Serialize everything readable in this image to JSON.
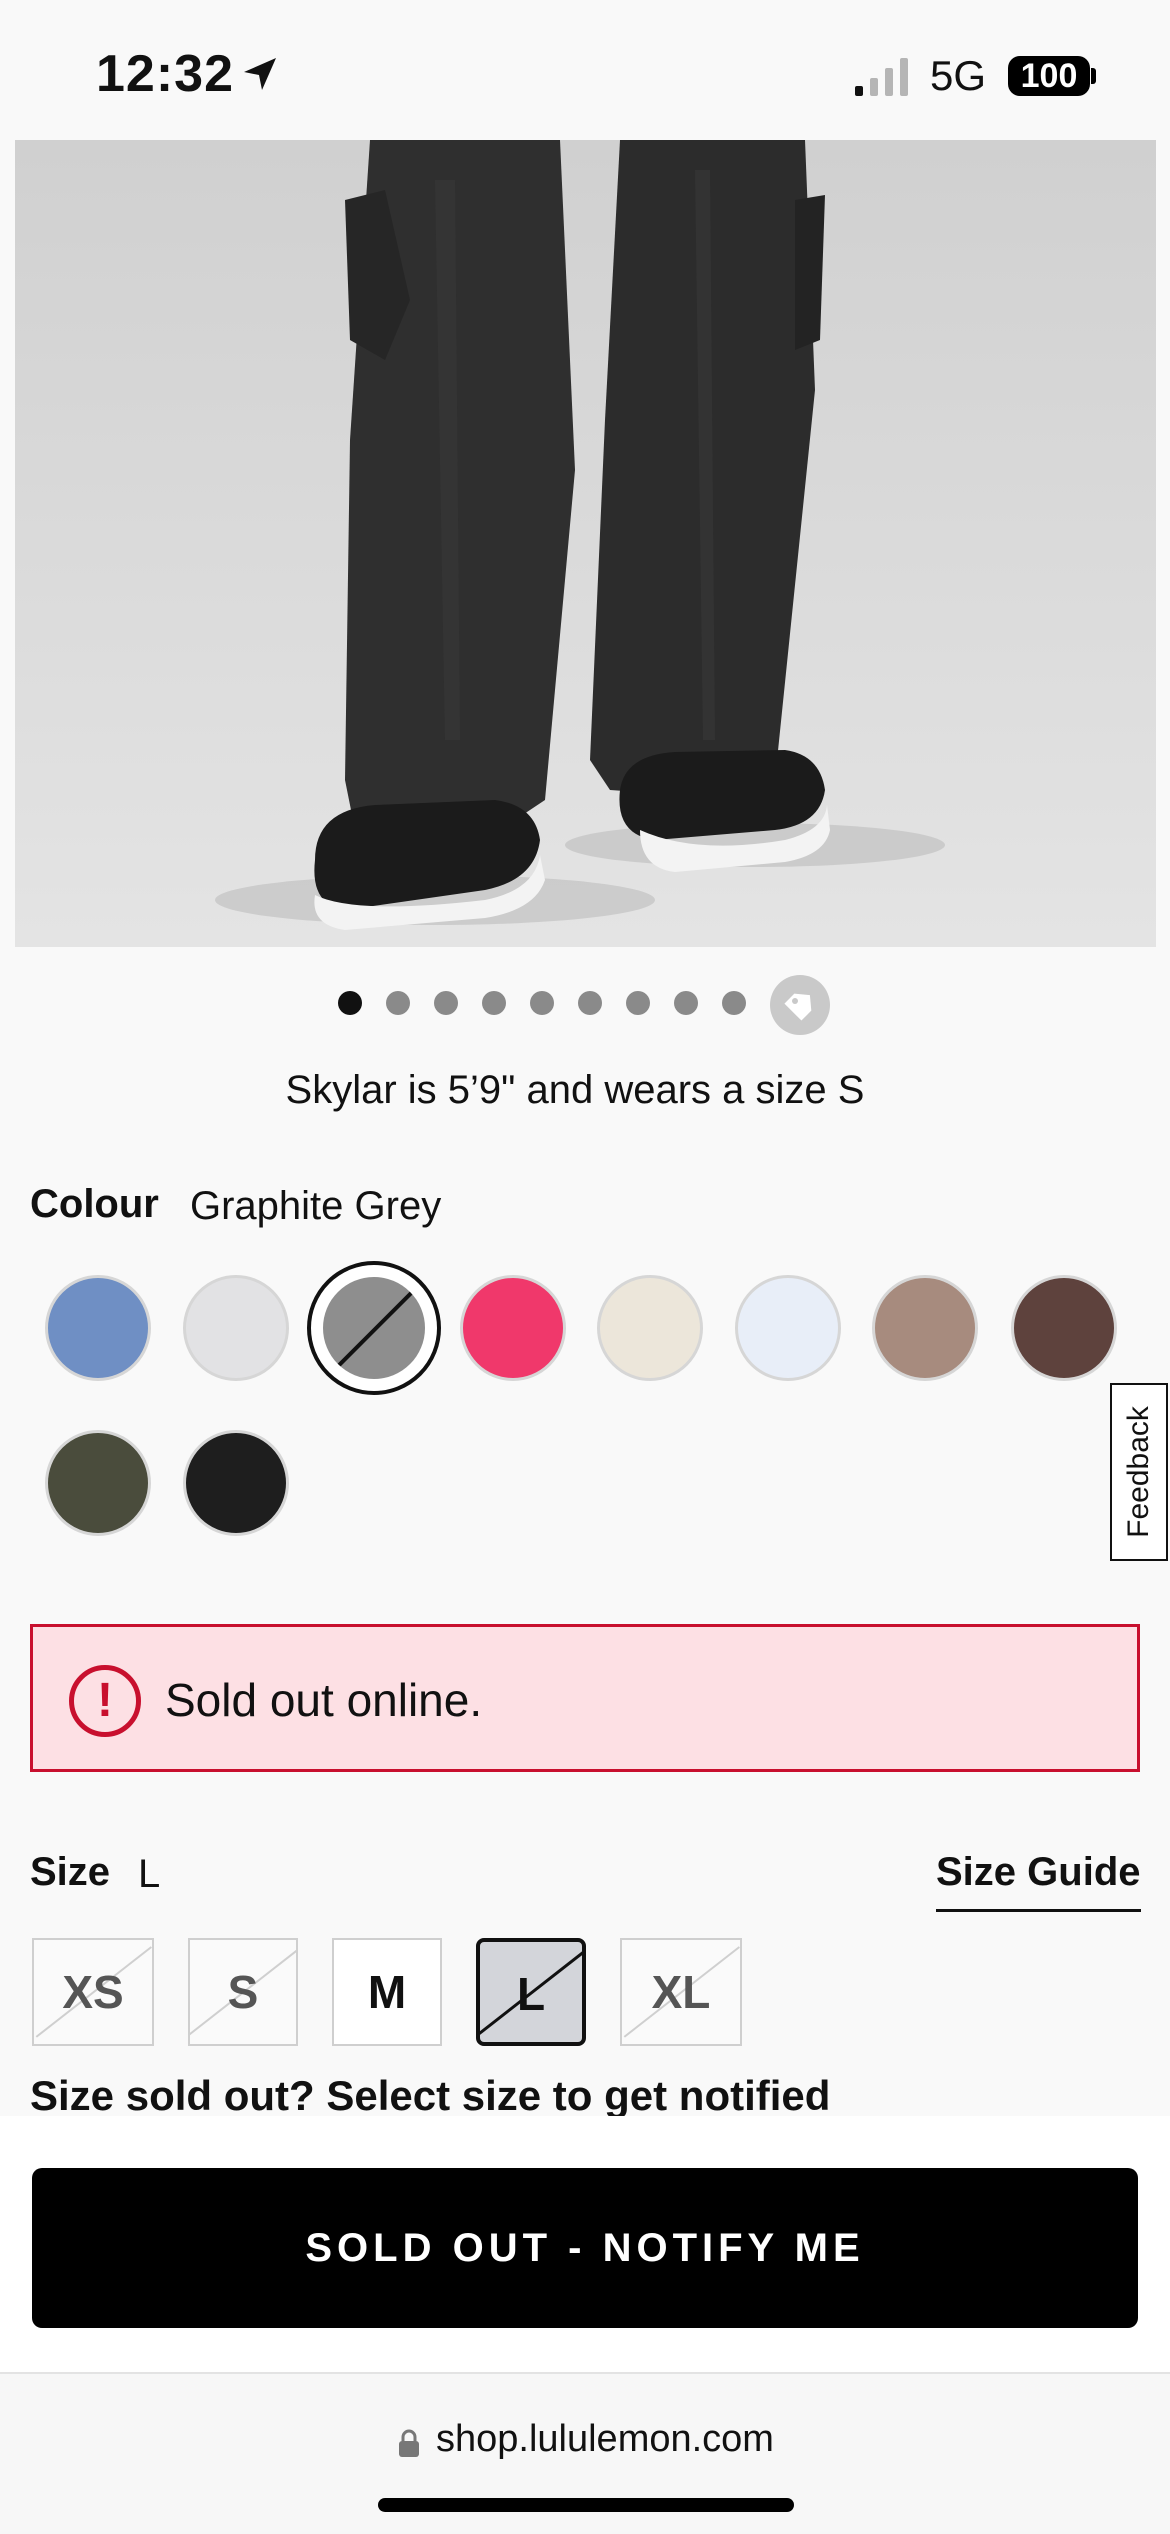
{
  "status_bar": {
    "time": "12:32",
    "network": "5G",
    "battery": "100"
  },
  "gallery": {
    "total_images": 9,
    "active_index": 0
  },
  "model_note": "Skylar is 5’9\" and wears a size S",
  "colour": {
    "label": "Colour",
    "selected_name": "Graphite Grey",
    "swatches": [
      {
        "color": "#6f8fc4"
      },
      {
        "color": "#e2e2e4"
      },
      {
        "color": "#8e8e8e",
        "selected": true,
        "sold_out": true
      },
      {
        "color": "#f0386b"
      },
      {
        "color": "#ece6da"
      },
      {
        "color": "#e8eef8"
      },
      {
        "color": "#a78b7e"
      },
      {
        "color": "#5e423d"
      },
      {
        "color": "#4a4c3c"
      },
      {
        "color": "#1e1e1e"
      }
    ]
  },
  "feedback_tab": "Feedback",
  "alert": {
    "icon": "!",
    "message": "Sold out online."
  },
  "size": {
    "label": "Size",
    "selected": "L",
    "guide_link": "Size Guide",
    "options": [
      {
        "label": "XS",
        "sold_out": true
      },
      {
        "label": "S",
        "sold_out": true
      },
      {
        "label": "M",
        "sold_out": false
      },
      {
        "label": "L",
        "sold_out": true,
        "selected": true
      },
      {
        "label": "XL",
        "sold_out": true
      }
    ],
    "hint": "Size sold out? Select size to get notified"
  },
  "cta": {
    "label": "SOLD OUT - NOTIFY ME"
  },
  "browser": {
    "url": "shop.lululemon.com"
  }
}
